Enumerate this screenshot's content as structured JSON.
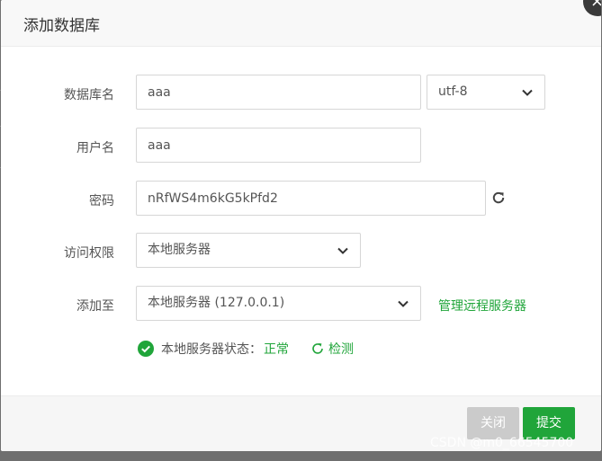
{
  "dialog": {
    "title": "添加数据库",
    "close_glyph": "×"
  },
  "form": {
    "db_name_label": "数据库名",
    "db_name_value": "aaa",
    "charset_value": "utf-8",
    "user_label": "用户名",
    "user_value": "aaa",
    "password_label": "密码",
    "password_value": "nRfWS4m6kG5kPfd2",
    "access_label": "访问权限",
    "access_value": "本地服务器",
    "add_to_label": "添加至",
    "add_to_value": "本地服务器 (127.0.0.1)",
    "manage_remote_link": "管理远程服务器"
  },
  "status": {
    "label": "本地服务器状态：",
    "value": "正常",
    "check_link": "检测"
  },
  "buttons": {
    "close_label": "关闭",
    "submit_label": "提交"
  },
  "watermark": "CSDN @m0_66545700",
  "colors": {
    "accent": "#20a53a",
    "disabled_button": "#cbcbcb",
    "overlay": "#6f6f6f"
  },
  "icons": {
    "refresh": "refresh-icon",
    "ok": "check-circle-icon",
    "check": "refresh-small-icon",
    "dropdown": "chevron-down-icon",
    "close": "close-icon"
  }
}
